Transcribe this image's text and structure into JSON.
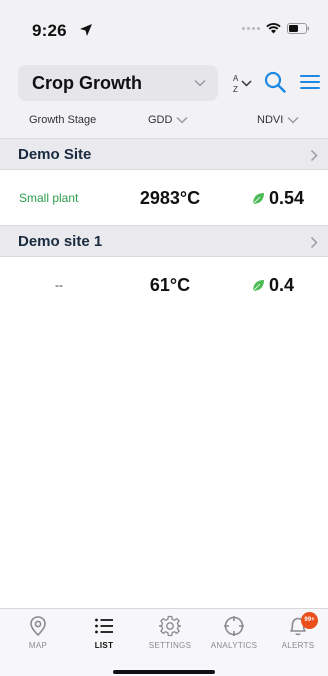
{
  "status_bar": {
    "time": "9:26"
  },
  "header": {
    "title": "Crop Growth"
  },
  "columns": {
    "stage": "Growth Stage",
    "gdd": "GDD",
    "ndvi": "NDVI"
  },
  "sites": [
    {
      "name": "Demo Site",
      "stage": "Small plant",
      "gdd": "2983°C",
      "ndvi": "0.54"
    },
    {
      "name": "Demo site 1",
      "stage": "--",
      "gdd": "61°C",
      "ndvi": "0.4"
    }
  ],
  "tabs": [
    {
      "label": "MAP",
      "icon": "map-pin-icon"
    },
    {
      "label": "LIST",
      "icon": "list-icon",
      "active": true
    },
    {
      "label": "SETTINGS",
      "icon": "gear-icon"
    },
    {
      "label": "ANALYTICS",
      "icon": "crosshair-icon"
    },
    {
      "label": "ALERTS",
      "icon": "bell-icon",
      "badge": "99+"
    }
  ],
  "colors": {
    "accent": "#1e88e5",
    "leaf": "#4cbb55",
    "stage": "#2e9e4e",
    "badge": "#e94e1b"
  }
}
